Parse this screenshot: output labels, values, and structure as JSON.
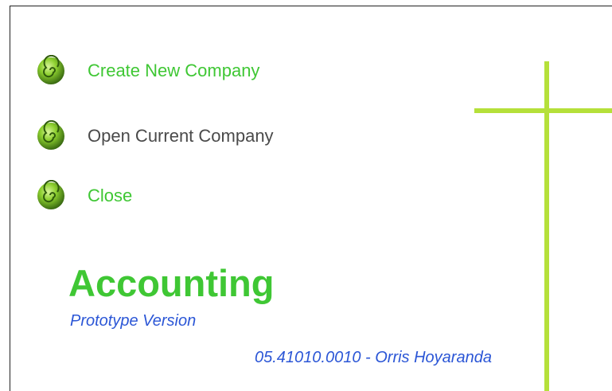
{
  "menu": {
    "items": [
      {
        "label": "Create New Company",
        "icon": "swirl-bullet-icon"
      },
      {
        "label": "Open Current Company",
        "icon": "swirl-bullet-icon"
      },
      {
        "label": "Close",
        "icon": "swirl-bullet-icon"
      }
    ]
  },
  "app": {
    "title": "Accounting",
    "subtitle": "Prototype Version",
    "credit": "05.41010.0010  -  Orris Hoyaranda"
  },
  "colors": {
    "accent_green": "#3fc734",
    "cross_green": "#b5e03a",
    "text_gray": "#4a4a4a",
    "text_blue": "#2b56d6"
  }
}
